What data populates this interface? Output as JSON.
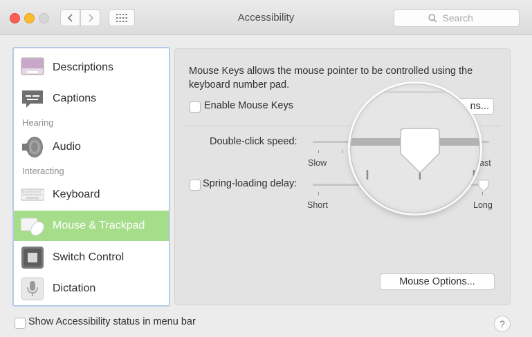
{
  "window": {
    "title": "Accessibility",
    "search_placeholder": "Search"
  },
  "sidebar": {
    "items": [
      {
        "label": "Descriptions",
        "icon": "descriptions-icon"
      },
      {
        "label": "Captions",
        "icon": "captions-icon"
      },
      {
        "label": "Audio",
        "icon": "speaker-icon"
      },
      {
        "label": "Keyboard",
        "icon": "keyboard-icon"
      },
      {
        "label": "Mouse & Trackpad",
        "icon": "mouse-trackpad-icon",
        "selected": true
      },
      {
        "label": "Switch Control",
        "icon": "switch-control-icon"
      },
      {
        "label": "Dictation",
        "icon": "microphone-icon"
      }
    ],
    "headers": {
      "hearing": "Hearing",
      "interacting": "Interacting"
    }
  },
  "panel": {
    "description_line1": "Mouse Keys allows the mouse pointer to be controlled using the",
    "description_line2": "keyboard number pad.",
    "enable_mouse_keys": "Enable Mouse Keys",
    "options_button_partial": "ns...",
    "double_click": {
      "label": "Double-click speed:",
      "min_label": "Slow",
      "max_label": "ast"
    },
    "spring_loading": {
      "label": "Spring-loading delay:",
      "min_label": "Short",
      "max_label": "Long"
    },
    "mouse_options_button": "Mouse Options..."
  },
  "footer": {
    "show_status_label": "Show Accessibility status in menu bar",
    "help": "?"
  },
  "colors": {
    "selection": "#a6dd8a",
    "sidebar_border": "#b6cbe8"
  }
}
